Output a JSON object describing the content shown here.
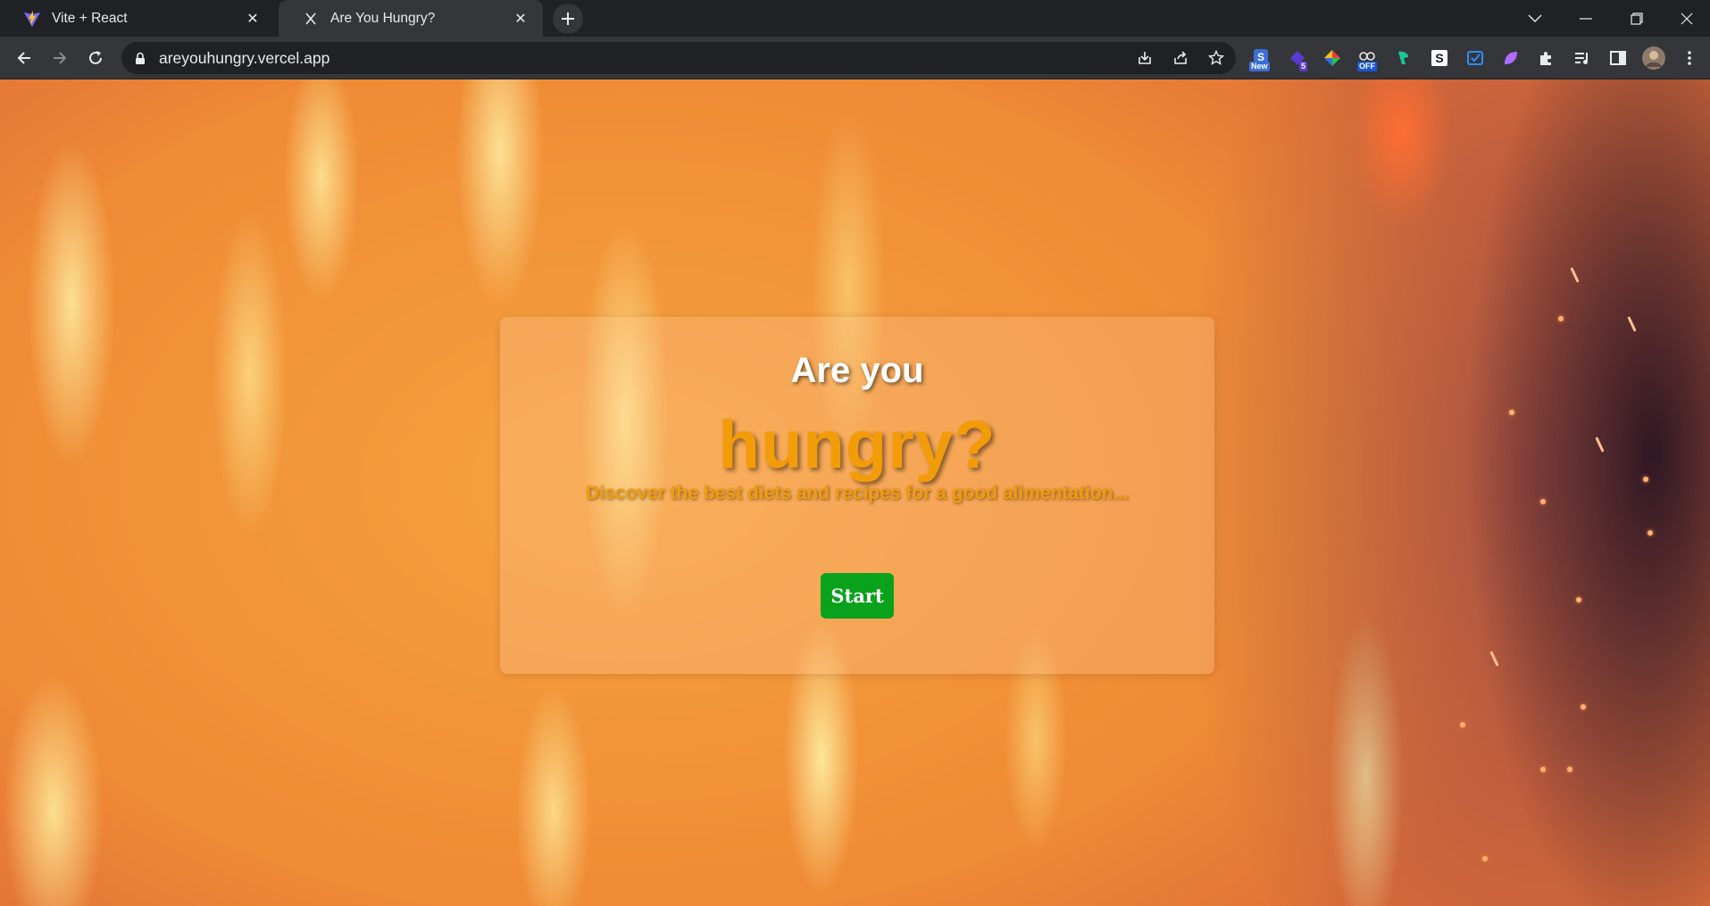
{
  "browser": {
    "tabs": [
      {
        "title": "Vite + React",
        "favicon": "vite-logo",
        "active": false
      },
      {
        "title": "Are You Hungry?",
        "favicon": "x-favicon",
        "active": true
      }
    ],
    "url": "areyouhungry.vercel.app",
    "extensions": [
      {
        "name": "extension-new-icon",
        "badge": "New"
      },
      {
        "name": "extension-5-icon",
        "badge": "5"
      },
      {
        "name": "extension-colorful-icon",
        "badge": ""
      },
      {
        "name": "extension-off-icon",
        "badge": "OFF"
      },
      {
        "name": "extension-green-icon",
        "badge": ""
      },
      {
        "name": "extension-s-icon",
        "badge": ""
      },
      {
        "name": "extension-blue-icon",
        "badge": ""
      },
      {
        "name": "extension-purple-icon",
        "badge": ""
      }
    ]
  },
  "hero": {
    "line1": "Are you",
    "line2": "hungry?",
    "tagline": "Discover the best diets and recipes for a good alimentation...",
    "start_label": "Start"
  },
  "colors": {
    "accent_orange": "#f39c09",
    "start_green": "#0aa21c",
    "chrome_dark": "#202124",
    "chrome_toolbar": "#35363a"
  }
}
